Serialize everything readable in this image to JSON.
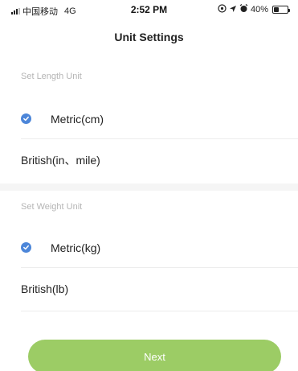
{
  "status_bar": {
    "carrier": "中国移动",
    "network": "4G",
    "time": "2:52 PM",
    "battery": "40%",
    "battery_level": 0.4,
    "icons": [
      "signal-icon",
      "location-icon",
      "alarm-icon",
      "battery-icon"
    ]
  },
  "header": {
    "title": "Unit Settings"
  },
  "length": {
    "section_label": "Set Length Unit",
    "options": [
      {
        "label": "Metric(cm)",
        "selected": true
      },
      {
        "label": "British(in、mile)",
        "selected": false
      }
    ]
  },
  "weight": {
    "section_label": "Set Weight Unit",
    "options": [
      {
        "label": "Metric(kg)",
        "selected": true
      },
      {
        "label": "British(lb)",
        "selected": false
      }
    ]
  },
  "footer": {
    "next_label": "Next"
  },
  "colors": {
    "accent_check": "#4c86d9",
    "button": "#9ccc65",
    "section_text": "#b5b5b5",
    "gap": "#f5f5f5"
  }
}
